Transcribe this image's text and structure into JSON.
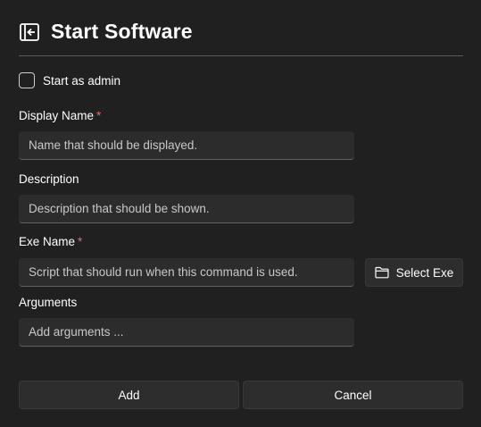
{
  "dialog": {
    "title": "Start Software",
    "header_icon": "pane-close-icon"
  },
  "admin_checkbox": {
    "label": "Start as admin",
    "checked": false
  },
  "fields": {
    "display_name": {
      "label": "Display Name",
      "required_mark": "*",
      "placeholder": "Name that should be displayed."
    },
    "description": {
      "label": "Description",
      "placeholder": "Description that should be shown."
    },
    "exe_name": {
      "label": "Exe Name",
      "required_mark": "*",
      "placeholder": "Script that should run when this command is used."
    },
    "arguments": {
      "label": "Arguments",
      "placeholder": "Add arguments ..."
    }
  },
  "buttons": {
    "select_exe": {
      "label": "Select Exe",
      "icon": "folder-icon"
    },
    "add": "Add",
    "cancel": "Cancel"
  },
  "colors": {
    "background": "#202020",
    "required": "#e06c6c",
    "input": "#2c2c2c"
  }
}
